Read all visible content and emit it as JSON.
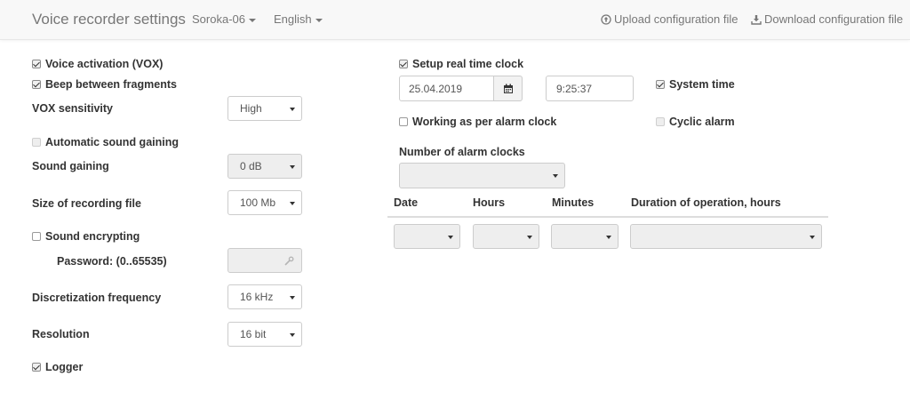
{
  "navbar": {
    "brand": "Voice recorder settings",
    "device_dropdown": "Soroka-06",
    "language_dropdown": "English",
    "upload_link": "Upload configuration file",
    "download_link": "Download configuration file"
  },
  "left": {
    "voice_activation": "Voice activation (VOX)",
    "beep": "Beep between fragments",
    "vox_sensitivity_label": "VOX sensitivity",
    "vox_sensitivity_value": "High",
    "auto_gaining": "Automatic sound gaining",
    "sound_gaining_label": "Sound gaining",
    "sound_gaining_value": "0 dB",
    "file_size_label": "Size of recording file",
    "file_size_value": "100 Mb",
    "encrypting": "Sound encrypting",
    "password_label": "Password: (0..65535)",
    "password_value": "",
    "freq_label": "Discretization frequency",
    "freq_value": "16 kHz",
    "resolution_label": "Resolution",
    "resolution_value": "16 bit",
    "logger": "Logger"
  },
  "right": {
    "rtc": "Setup real time clock",
    "date_value": "25.04.2019",
    "time_value": "9:25:37",
    "system_time": "System time",
    "alarm_clock": "Working as per alarm clock",
    "cyclic_alarm": "Cyclic alarm",
    "alarm_count_label": "Number of alarm clocks",
    "alarm_count_value": "",
    "table": {
      "headers": [
        "Date",
        "Hours",
        "Minutes",
        "Duration of operation, hours"
      ]
    }
  },
  "icons": {
    "upload": "upload-circle-icon",
    "download": "download-icon",
    "calendar": "calendar-icon",
    "wrench": "wrench-icon"
  }
}
